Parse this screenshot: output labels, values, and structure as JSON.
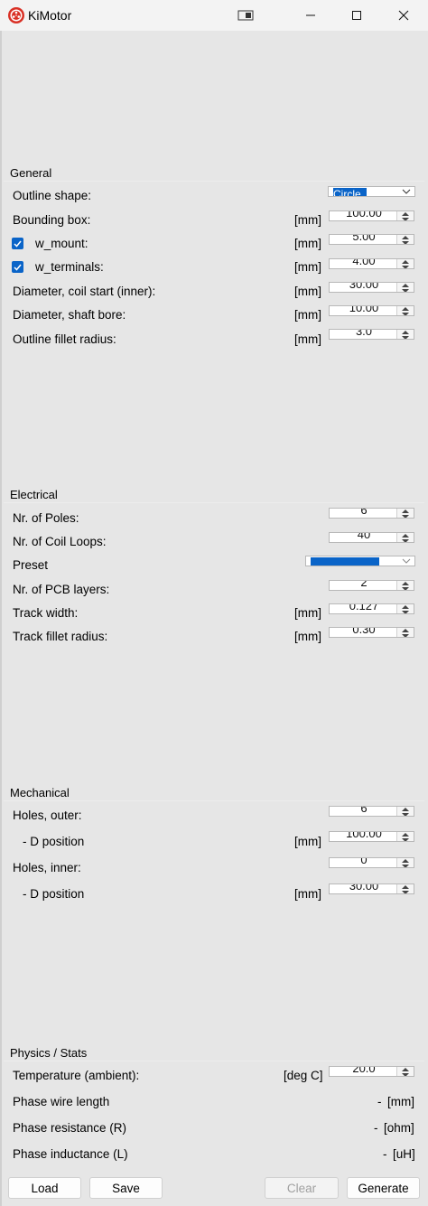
{
  "window": {
    "title": "KiMotor"
  },
  "general": {
    "title": "General",
    "outline_shape": {
      "label": "Outline shape:",
      "value": "Circle"
    },
    "bounding_box": {
      "label": "Bounding box:",
      "unit": "[mm]",
      "value": "100.00"
    },
    "w_mount": {
      "label": "w_mount:",
      "unit": "[mm]",
      "value": "5.00",
      "checked": true
    },
    "w_terminals": {
      "label": "w_terminals:",
      "unit": "[mm]",
      "value": "4.00",
      "checked": true
    },
    "coil_start": {
      "label": "Diameter, coil start (inner):",
      "unit": "[mm]",
      "value": "30.00"
    },
    "shaft_bore": {
      "label": "Diameter, shaft bore:",
      "unit": "[mm]",
      "value": "10.00"
    },
    "outline_fillet": {
      "label": "Outline fillet radius:",
      "unit": "[mm]",
      "value": "3.0"
    }
  },
  "electrical": {
    "title": "Electrical",
    "poles": {
      "label": "Nr. of Poles:",
      "value": "6"
    },
    "coil_loops": {
      "label": "Nr. of Coil Loops:",
      "value": "40"
    },
    "preset": {
      "label": "Preset"
    },
    "pcb_layers": {
      "label": "Nr. of PCB layers:",
      "value": "2"
    },
    "track_width": {
      "label": "Track width:",
      "unit": "[mm]",
      "value": "0.127"
    },
    "track_fillet": {
      "label": "Track fillet radius:",
      "unit": "[mm]",
      "value": "0.30"
    }
  },
  "mechanical": {
    "title": "Mechanical",
    "holes_outer": {
      "label": "Holes, outer:",
      "value": "6"
    },
    "outer_d_pos": {
      "label": "- D position",
      "unit": "[mm]",
      "value": "100.00"
    },
    "holes_inner": {
      "label": "Holes, inner:",
      "value": "0"
    },
    "inner_d_pos": {
      "label": "- D position",
      "unit": "[mm]",
      "value": "30.00"
    }
  },
  "physics": {
    "title": "Physics / Stats",
    "temperature": {
      "label": "Temperature (ambient):",
      "unit": "[deg C]",
      "value": "20.0"
    },
    "wire_length": {
      "label": "Phase wire length",
      "value": "-",
      "unit": "[mm]"
    },
    "resistance": {
      "label": "Phase resistance (R)",
      "value": "-",
      "unit": "[ohm]"
    },
    "inductance": {
      "label": "Phase inductance (L)",
      "value": "-",
      "unit": "[uH]"
    }
  },
  "buttons": {
    "load": "Load",
    "save": "Save",
    "clear": "Clear",
    "generate": "Generate"
  },
  "colors": {
    "accent": "#0a64c8",
    "background": "#e6e6e6",
    "logo": "#d93025"
  }
}
